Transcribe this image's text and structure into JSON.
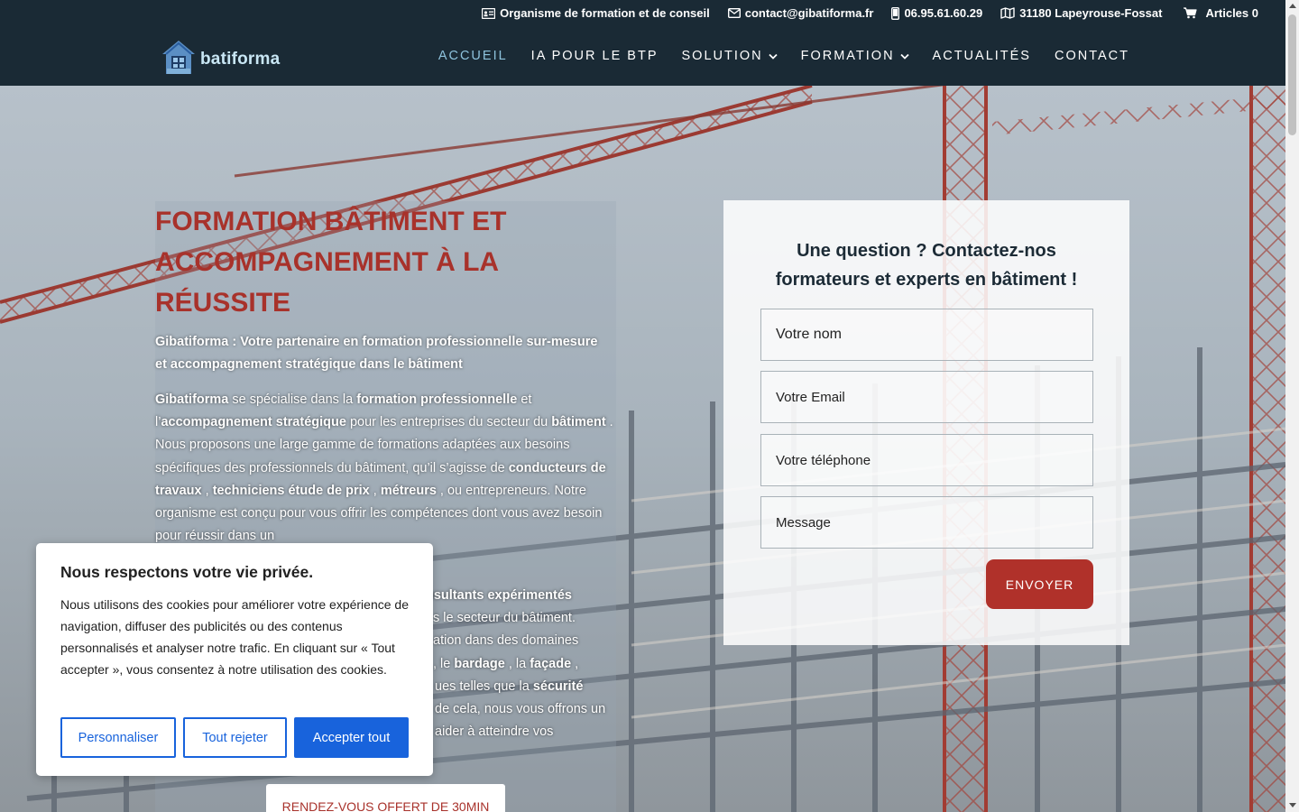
{
  "topbar": {
    "items": [
      {
        "icon": "id-card-icon",
        "text": "Organisme de formation et de conseil"
      },
      {
        "icon": "envelope-icon",
        "text": "contact@gibatiforma.fr"
      },
      {
        "icon": "phone-icon",
        "text": "06.95.61.60.29"
      },
      {
        "icon": "map-icon",
        "text": "31180 Lapeyrouse-Fossat"
      },
      {
        "icon": "cart-icon",
        "text": "Articles 0"
      }
    ]
  },
  "logo": {
    "text": "batiforma"
  },
  "nav": {
    "items": [
      {
        "label": "ACCUEIL",
        "active": true
      },
      {
        "label": "IA POUR LE BTP"
      },
      {
        "label": "SOLUTION",
        "dropdown": true
      },
      {
        "label": "FORMATION",
        "dropdown": true
      },
      {
        "label": "ACTUALITÉS"
      },
      {
        "label": "CONTACT"
      }
    ]
  },
  "hero": {
    "title": "FORMATION BÂTIMENT ET ACCOMPAGNEMENT À LA RÉUSSITE",
    "lead": "Gibatiforma : Votre partenaire en formation professionnelle sur-mesure et accompagnement stratégique dans le bâtiment",
    "paragraph": {
      "p1": "Gibatiforma",
      "p2": " se spécialise dans la ",
      "p3": "formation professionnelle",
      "p4": " et l’",
      "p5": "accompagnement stratégique",
      "p6": " pour les entreprises du secteur du ",
      "p7": "bâtiment",
      "p8": " . Nous proposons une large gamme de formations adaptées aux besoins spécifiques des professionnels du bâtiment, qu’il s’agisse de ",
      "p9": "conducteurs de travaux",
      "p10": " , ",
      "p11": "techniciens étude de prix",
      "p12": " , ",
      "p13": "métreurs",
      "p14": " , ou entrepreneurs. Notre organisme est conçu pour vous offrir les compétences dont vous avez besoin pour réussir dans un"
    },
    "paragraph2": {
      "q1": "nsultants expérimentés",
      "q2": "s le secteur du bâtiment.",
      "q3": "ation dans des domaines",
      "q4": ", le ",
      "q5": "bardage",
      "q6": " , la ",
      "q7": "façade",
      "q8": " ,",
      "q9": "ues telles que la ",
      "q10": "sécurité",
      "q11": "de cela, nous vous offrons un",
      "q12": "aider à atteindre vos"
    },
    "cta": "RENDEZ-VOUS OFFERT DE 30MIN"
  },
  "form": {
    "title": "Une question ? Contactez-nos formateurs et experts en bâtiment !",
    "name_placeholder": "Votre nom",
    "email_placeholder": "Votre Email",
    "phone_placeholder": "Votre téléphone",
    "message_placeholder": "Message",
    "submit": "ENVOYER"
  },
  "cookie": {
    "title": "Nous respectons votre vie privée.",
    "text": "Nous utilisons des cookies pour améliorer votre expérience de navigation, diffuser des publicités ou des contenus personnalisés et analyser notre trafic. En cliquant sur « Tout accepter », vous consentez à notre utilisation des cookies.",
    "customize": "Personnaliser",
    "reject": "Tout rejeter",
    "accept": "Accepter tout"
  },
  "colors": {
    "header_bg": "#1a2a35",
    "title_red": "#a8322b",
    "button_red": "#b0312a",
    "nav_active": "#8ec3dd",
    "cookie_blue": "#1863dc"
  }
}
